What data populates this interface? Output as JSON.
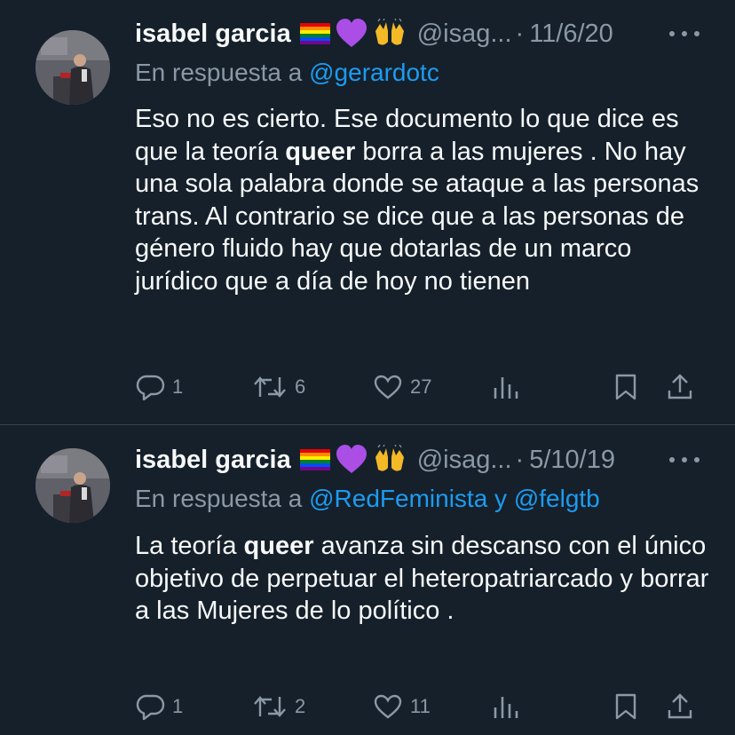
{
  "tweets": [
    {
      "author_name": "isabel garcia",
      "emoji_icons": [
        "rainbow-flag-icon",
        "purple-heart-icon",
        "raising-hands-icon"
      ],
      "handle": "@isag...",
      "separator": "·",
      "date": "11/6/20",
      "reply_prefix": "En respuesta a",
      "reply_mentions": "@gerardotc",
      "text_before": "Eso no es cierto. Ese documento lo que dice es que la teoría ",
      "text_bold": "queer",
      "text_after": " borra a las mujeres . No hay una sola palabra donde se ataque a las personas trans. Al contrario se dice que a las personas de género fluido hay que dotarlas de un marco jurídico que a día de hoy no tienen",
      "reply_count": "1",
      "retweet_count": "6",
      "like_count": "27"
    },
    {
      "author_name": "isabel garcia",
      "emoji_icons": [
        "rainbow-flag-icon",
        "purple-heart-icon",
        "raising-hands-icon"
      ],
      "handle": "@isag...",
      "separator": "·",
      "date": "5/10/19",
      "reply_prefix": "En respuesta a",
      "reply_mentions": "@RedFeminista y @felgtb",
      "text_before": "La teoría ",
      "text_bold": "queer",
      "text_after": " avanza sin descanso con el único objetivo de perpetuar el heteropatriarcado y borrar a las Mujeres de lo político .",
      "reply_count": "1",
      "retweet_count": "2",
      "like_count": "11"
    }
  ],
  "colors": {
    "background": "#15202b",
    "primary_text": "#f7f9f9",
    "secondary_text": "#8b98a5",
    "link": "#1d9bf0",
    "divider": "#38444d"
  },
  "action_icons": [
    "reply-icon",
    "retweet-icon",
    "like-icon",
    "views-icon",
    "bookmark-icon",
    "share-icon"
  ]
}
